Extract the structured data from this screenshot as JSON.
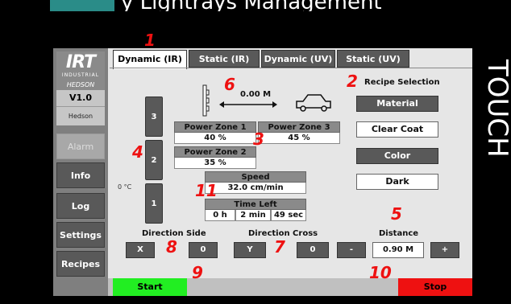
{
  "header_fragment": "y Lightrays Management",
  "logo": {
    "brand": "IRT",
    "sub": "INDUSTRIAL",
    "partner": "HEDSON"
  },
  "version": "V1.0",
  "site_name": "Hedson",
  "sidebar": {
    "alarm": "Alarm",
    "info": "Info",
    "log": "Log",
    "settings": "Settings",
    "recipes": "Recipes"
  },
  "tabs": [
    "Dynamic (IR)",
    "Static (IR)",
    "Dynamic (UV)",
    "Static (UV)"
  ],
  "touch_label": "TOUCH",
  "zones": {
    "z3": "3",
    "z2": "2",
    "z1": "1",
    "temperature": "0 °C"
  },
  "lamp_distance": "0.00 M",
  "power_zones": {
    "pz1_label": "Power Zone 1",
    "pz1_value": "40 %",
    "pz3_label": "Power Zone 3",
    "pz3_value": "45 %",
    "pz2_label": "Power Zone 2",
    "pz2_value": "35 %"
  },
  "speed": {
    "label": "Speed",
    "value": "32.0 cm/min"
  },
  "time_left": {
    "label": "Time Left",
    "hours": "0 h",
    "minutes": "2 min",
    "seconds": "49 sec"
  },
  "recipe": {
    "title": "Recipe Selection",
    "items": [
      "Material",
      "Clear Coat",
      "Color",
      "Dark"
    ]
  },
  "direction_side": {
    "label": "Direction Side",
    "axis": "X",
    "value": "0"
  },
  "direction_cross": {
    "label": "Direction Cross",
    "axis": "Y",
    "value": "0"
  },
  "distance": {
    "label": "Distance",
    "minus": "-",
    "value": "0.90 M",
    "plus": "+"
  },
  "actions": {
    "start": "Start",
    "stop": "Stop"
  },
  "annotations": [
    "1",
    "2",
    "3",
    "4",
    "5",
    "6",
    "7",
    "8",
    "9",
    "10",
    "11"
  ],
  "colors": {
    "start": "#22ee22",
    "stop": "#ee1111",
    "annotation": "#ee1111"
  }
}
